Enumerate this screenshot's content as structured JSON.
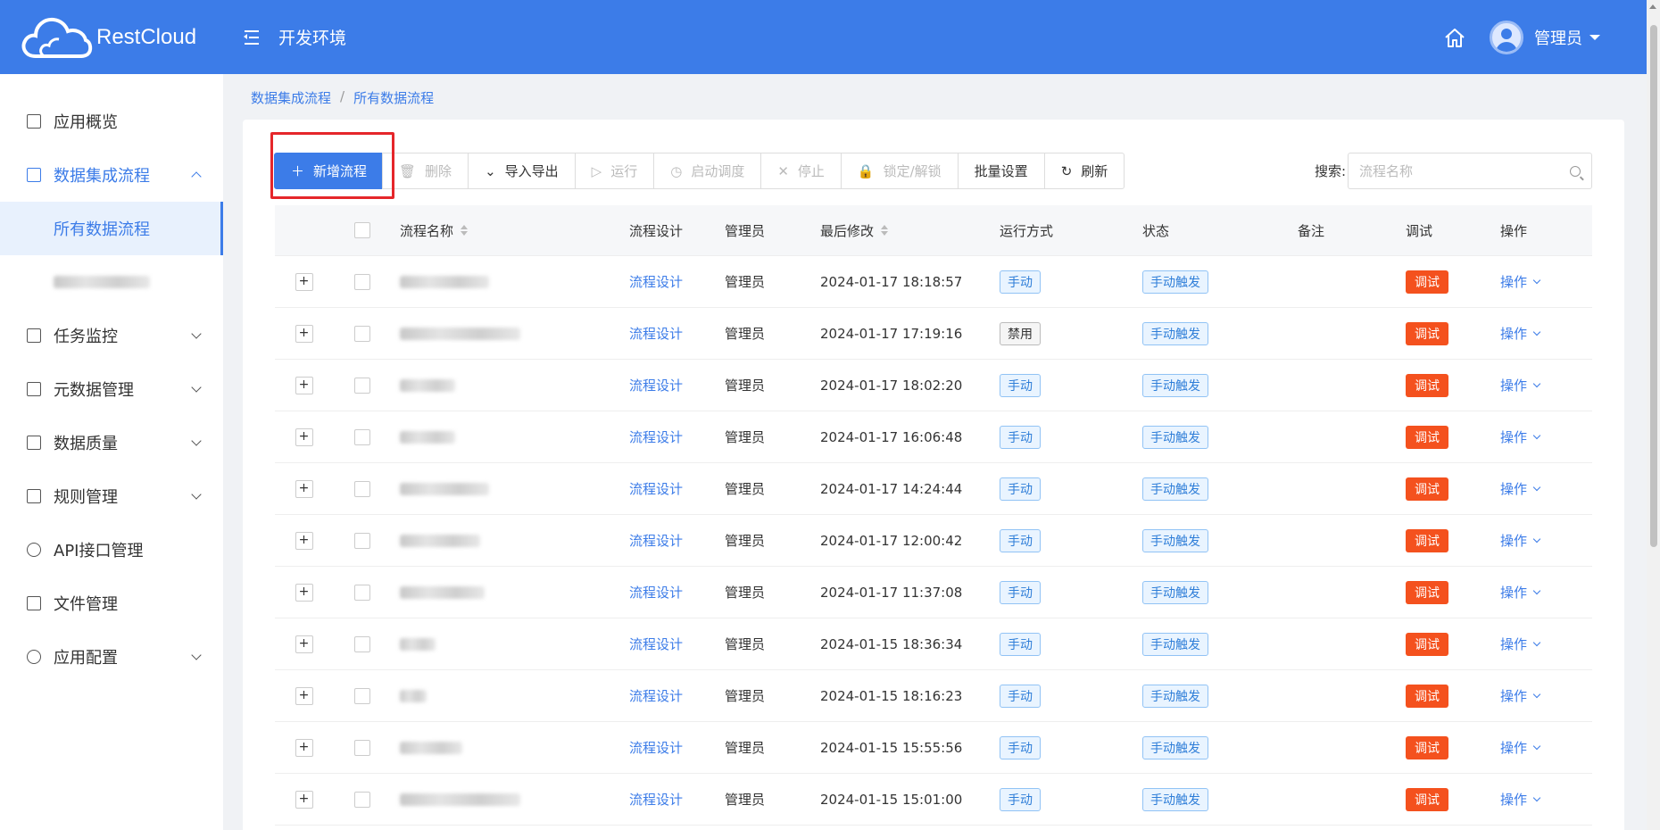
{
  "header": {
    "logo_text": "RestCloud",
    "env_label": "开发环境",
    "user_name": "管理员"
  },
  "breadcrumb": {
    "items": [
      "数据集成流程",
      "所有数据流程"
    ],
    "separator": "/"
  },
  "sidebar": {
    "items": [
      {
        "label": "应用概览",
        "icon": "overview-icon",
        "has_children": false
      },
      {
        "label": "数据集成流程",
        "icon": "grid-icon",
        "has_children": true,
        "expanded": true
      },
      {
        "label": "任务监控",
        "icon": "monitor-icon",
        "has_children": true
      },
      {
        "label": "元数据管理",
        "icon": "metadata-icon",
        "has_children": true
      },
      {
        "label": "数据质量",
        "icon": "quality-icon",
        "has_children": true
      },
      {
        "label": "规则管理",
        "icon": "terminal-icon",
        "has_children": true
      },
      {
        "label": "API接口管理",
        "icon": "api-icon",
        "has_children": false
      },
      {
        "label": "文件管理",
        "icon": "file-icon",
        "has_children": false
      },
      {
        "label": "应用配置",
        "icon": "gear-icon",
        "has_children": true
      }
    ],
    "sub_items": [
      "所有数据流程"
    ]
  },
  "toolbar": {
    "add": "新增流程",
    "delete": "删除",
    "import_export": "导入导出",
    "run": "运行",
    "schedule": "启动调度",
    "stop": "停止",
    "lock": "锁定/解锁",
    "batch": "批量设置",
    "refresh": "刷新"
  },
  "search": {
    "label": "搜索:",
    "placeholder": "流程名称"
  },
  "table": {
    "columns": {
      "name": "流程名称",
      "design": "流程设计",
      "admin": "管理员",
      "modified": "最后修改",
      "mode": "运行方式",
      "status": "状态",
      "note": "备注",
      "debug": "调试",
      "op": "操作"
    },
    "rows": [
      {
        "design": "流程设计",
        "admin": "管理员",
        "modified": "2024-01-17 18:18:57",
        "mode": "手动",
        "status": "手动触发",
        "debug": "调试",
        "op": "操作"
      },
      {
        "design": "流程设计",
        "admin": "管理员",
        "modified": "2024-01-17 17:19:16",
        "mode": "禁用",
        "status": "手动触发",
        "debug": "调试",
        "op": "操作"
      },
      {
        "design": "流程设计",
        "admin": "管理员",
        "modified": "2024-01-17 18:02:20",
        "mode": "手动",
        "status": "手动触发",
        "debug": "调试",
        "op": "操作"
      },
      {
        "design": "流程设计",
        "admin": "管理员",
        "modified": "2024-01-17 16:06:48",
        "mode": "手动",
        "status": "手动触发",
        "debug": "调试",
        "op": "操作"
      },
      {
        "design": "流程设计",
        "admin": "管理员",
        "modified": "2024-01-17 14:24:44",
        "mode": "手动",
        "status": "手动触发",
        "debug": "调试",
        "op": "操作"
      },
      {
        "design": "流程设计",
        "admin": "管理员",
        "modified": "2024-01-17 12:00:42",
        "mode": "手动",
        "status": "手动触发",
        "debug": "调试",
        "op": "操作"
      },
      {
        "design": "流程设计",
        "admin": "管理员",
        "modified": "2024-01-17 11:37:08",
        "mode": "手动",
        "status": "手动触发",
        "debug": "调试",
        "op": "操作"
      },
      {
        "design": "流程设计",
        "admin": "管理员",
        "modified": "2024-01-15 18:36:34",
        "mode": "手动",
        "status": "手动触发",
        "debug": "调试",
        "op": "操作"
      },
      {
        "design": "流程设计",
        "admin": "管理员",
        "modified": "2024-01-15 18:16:23",
        "mode": "手动",
        "status": "手动触发",
        "debug": "调试",
        "op": "操作"
      },
      {
        "design": "流程设计",
        "admin": "管理员",
        "modified": "2024-01-15 15:55:56",
        "mode": "手动",
        "status": "手动触发",
        "debug": "调试",
        "op": "操作"
      },
      {
        "design": "流程设计",
        "admin": "管理员",
        "modified": "2024-01-15 15:01:00",
        "mode": "手动",
        "status": "手动触发",
        "debug": "调试",
        "op": "操作"
      }
    ]
  },
  "colors": {
    "primary": "#3c7ce8",
    "debug": "#f4511e",
    "highlight": "#e5262a"
  }
}
